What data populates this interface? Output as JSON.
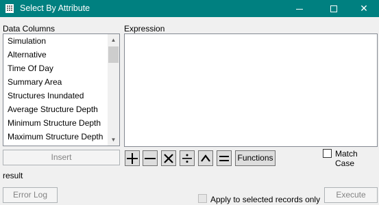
{
  "window": {
    "title": "Select By Attribute",
    "icons": {
      "app": "table-icon",
      "minimize": "minimize-icon",
      "maximize": "maximize-icon",
      "close": "close-icon"
    },
    "close_glyph": "✕"
  },
  "data_columns": {
    "label": "Data Columns",
    "items": [
      "Simulation",
      "Alternative",
      "Time Of Day",
      "Summary Area",
      "Structures Inundated",
      "Average Structure Depth",
      "Minimum Structure Depth",
      "Maximum Structure Depth"
    ],
    "scroll_up_glyph": "▲",
    "scroll_down_glyph": "▼"
  },
  "expression": {
    "label": "Expression",
    "value": ""
  },
  "insert_button": "Insert",
  "operators": [
    {
      "name": "plus",
      "icon": "plus-icon"
    },
    {
      "name": "minus",
      "icon": "minus-icon"
    },
    {
      "name": "multiply",
      "icon": "multiply-icon"
    },
    {
      "name": "divide",
      "icon": "divide-icon"
    },
    {
      "name": "power",
      "icon": "caret-icon"
    },
    {
      "name": "equals",
      "icon": "equals-icon"
    }
  ],
  "functions_button": "Functions",
  "match_case": {
    "label": "Match Case",
    "checked": false
  },
  "result_label": "result",
  "error_log_button": "Error Log",
  "apply_selected": {
    "label": "Apply to selected records only",
    "checked": false
  },
  "execute_button": "Execute",
  "colors": {
    "titlebar": "#008080",
    "window_bg": "#f0f0f0",
    "disabled_text": "#838383"
  }
}
